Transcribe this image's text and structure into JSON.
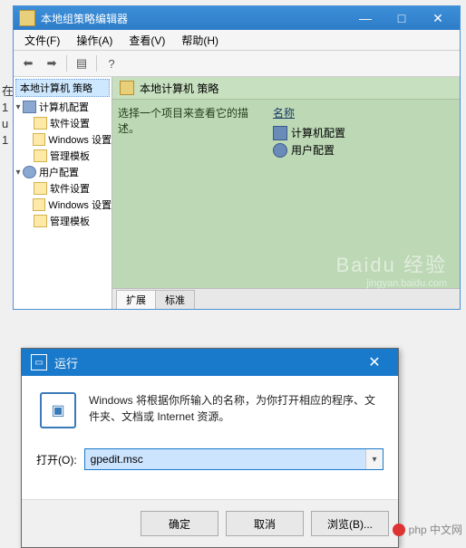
{
  "gpedit": {
    "title": "本地组策略编辑器",
    "menu": {
      "file": "文件(F)",
      "action": "操作(A)",
      "view": "查看(V)",
      "help": "帮助(H)"
    },
    "tree": {
      "root": "本地计算机 策略",
      "computer": "计算机配置",
      "user": "用户配置",
      "children": {
        "soft": "软件设置",
        "win": "Windows 设置",
        "admin": "管理模板"
      }
    },
    "right": {
      "header": "本地计算机 策略",
      "desc": "选择一个项目来查看它的描述。",
      "name_col": "名称",
      "items": {
        "computer": "计算机配置",
        "user": "用户配置"
      }
    },
    "tabs": {
      "extended": "扩展",
      "standard": "标准"
    }
  },
  "run": {
    "title": "运行",
    "desc": "Windows 将根据你所输入的名称，为你打开相应的程序、文件夹、文档或 Internet 资源。",
    "open_label": "打开(O):",
    "value": "gpedit.msc",
    "buttons": {
      "ok": "确定",
      "cancel": "取消",
      "browse": "浏览(B)..."
    }
  },
  "watermark": {
    "logo": "Baidu 经验",
    "url": "jingyan.baidu.com"
  },
  "php_wm": "php 中文网"
}
